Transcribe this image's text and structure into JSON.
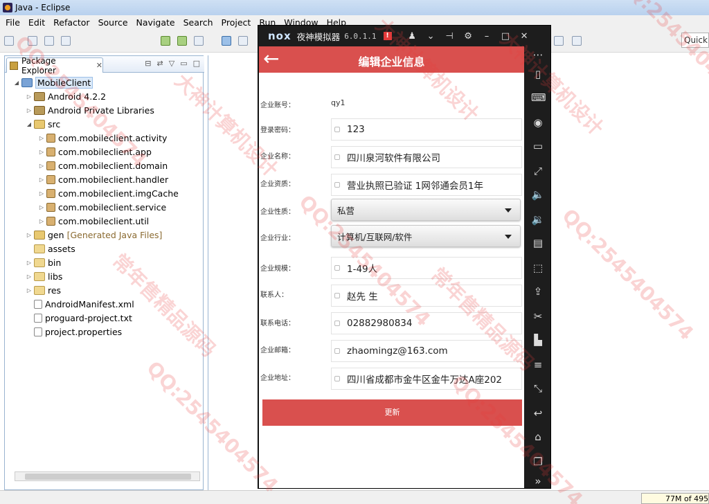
{
  "window": {
    "title": "Java - Eclipse"
  },
  "menu": [
    "File",
    "Edit",
    "Refactor",
    "Source",
    "Navigate",
    "Search",
    "Project",
    "Run",
    "Window",
    "Help"
  ],
  "toolbar": {
    "quick_access": "Quick A"
  },
  "package_explorer": {
    "tab_label": "Package Explorer",
    "tab_close": "✕",
    "tree": [
      {
        "label": "MobileClient",
        "level": 0,
        "expanded": true,
        "icon": "project-icon",
        "selected": true
      },
      {
        "label": "Android 4.2.2",
        "level": 1,
        "expanded": false,
        "icon": "library-icon"
      },
      {
        "label": "Android Private Libraries",
        "level": 1,
        "expanded": false,
        "icon": "library-icon"
      },
      {
        "label": "src",
        "level": 1,
        "expanded": true,
        "icon": "source-folder-icon"
      },
      {
        "label": "com.mobileclient.activity",
        "level": 2,
        "expanded": false,
        "icon": "package-icon"
      },
      {
        "label": "com.mobileclient.app",
        "level": 2,
        "expanded": false,
        "icon": "package-icon"
      },
      {
        "label": "com.mobileclient.domain",
        "level": 2,
        "expanded": false,
        "icon": "package-icon"
      },
      {
        "label": "com.mobileclient.handler",
        "level": 2,
        "expanded": false,
        "icon": "package-icon"
      },
      {
        "label": "com.mobileclient.imgCache",
        "level": 2,
        "expanded": false,
        "icon": "package-icon"
      },
      {
        "label": "com.mobileclient.service",
        "level": 2,
        "expanded": false,
        "icon": "package-icon"
      },
      {
        "label": "com.mobileclient.util",
        "level": 2,
        "expanded": false,
        "icon": "package-icon"
      },
      {
        "label": "gen",
        "decoration": "[Generated Java Files]",
        "level": 1,
        "expanded": false,
        "icon": "source-folder-icon"
      },
      {
        "label": "assets",
        "level": 1,
        "icon": "folder-icon"
      },
      {
        "label": "bin",
        "level": 1,
        "expanded": false,
        "icon": "folder-icon"
      },
      {
        "label": "libs",
        "level": 1,
        "expanded": false,
        "icon": "folder-icon"
      },
      {
        "label": "res",
        "level": 1,
        "expanded": false,
        "icon": "folder-icon"
      },
      {
        "label": "AndroidManifest.xml",
        "level": 1,
        "icon": "xml-file-icon"
      },
      {
        "label": "proguard-project.txt",
        "level": 1,
        "icon": "text-file-icon"
      },
      {
        "label": "project.properties",
        "level": 1,
        "icon": "text-file-icon"
      }
    ]
  },
  "status": {
    "heap": "77M of 495"
  },
  "emulator": {
    "logo": "nox",
    "name": "夜神模拟器",
    "version": "6.0.1.1",
    "alert": "!"
  },
  "app": {
    "title": "编辑企业信息",
    "back_glyph": "←",
    "fields": {
      "account": {
        "label": "企业账号：",
        "value": "qy1"
      },
      "password": {
        "label": "登录密码：",
        "value": "123"
      },
      "name": {
        "label": "企业名称：",
        "value": "四川泉河软件有限公司"
      },
      "qualification": {
        "label": "企业资质：",
        "value": "营业执照已验证 1网邻通会员1年"
      },
      "nature": {
        "label": "企业性质：",
        "value": "私营"
      },
      "industry": {
        "label": "企业行业：",
        "value": "计算机/互联网/软件"
      },
      "scale": {
        "label": "企业规模：",
        "value": "1-49人"
      },
      "contact": {
        "label": "联系人：",
        "value": "赵先 生"
      },
      "phone": {
        "label": "联系电话：",
        "value": "02882980834"
      },
      "email": {
        "label": "企业邮箱：",
        "value": "zhaomingz@163.com"
      },
      "address": {
        "label": "企业地址：",
        "value": "四川省成都市金牛区金牛万达A座202"
      }
    },
    "update_label": "更新"
  },
  "watermarks": [
    "大神计算机设计",
    "QQ:2545404574",
    "常年售精品源码"
  ]
}
